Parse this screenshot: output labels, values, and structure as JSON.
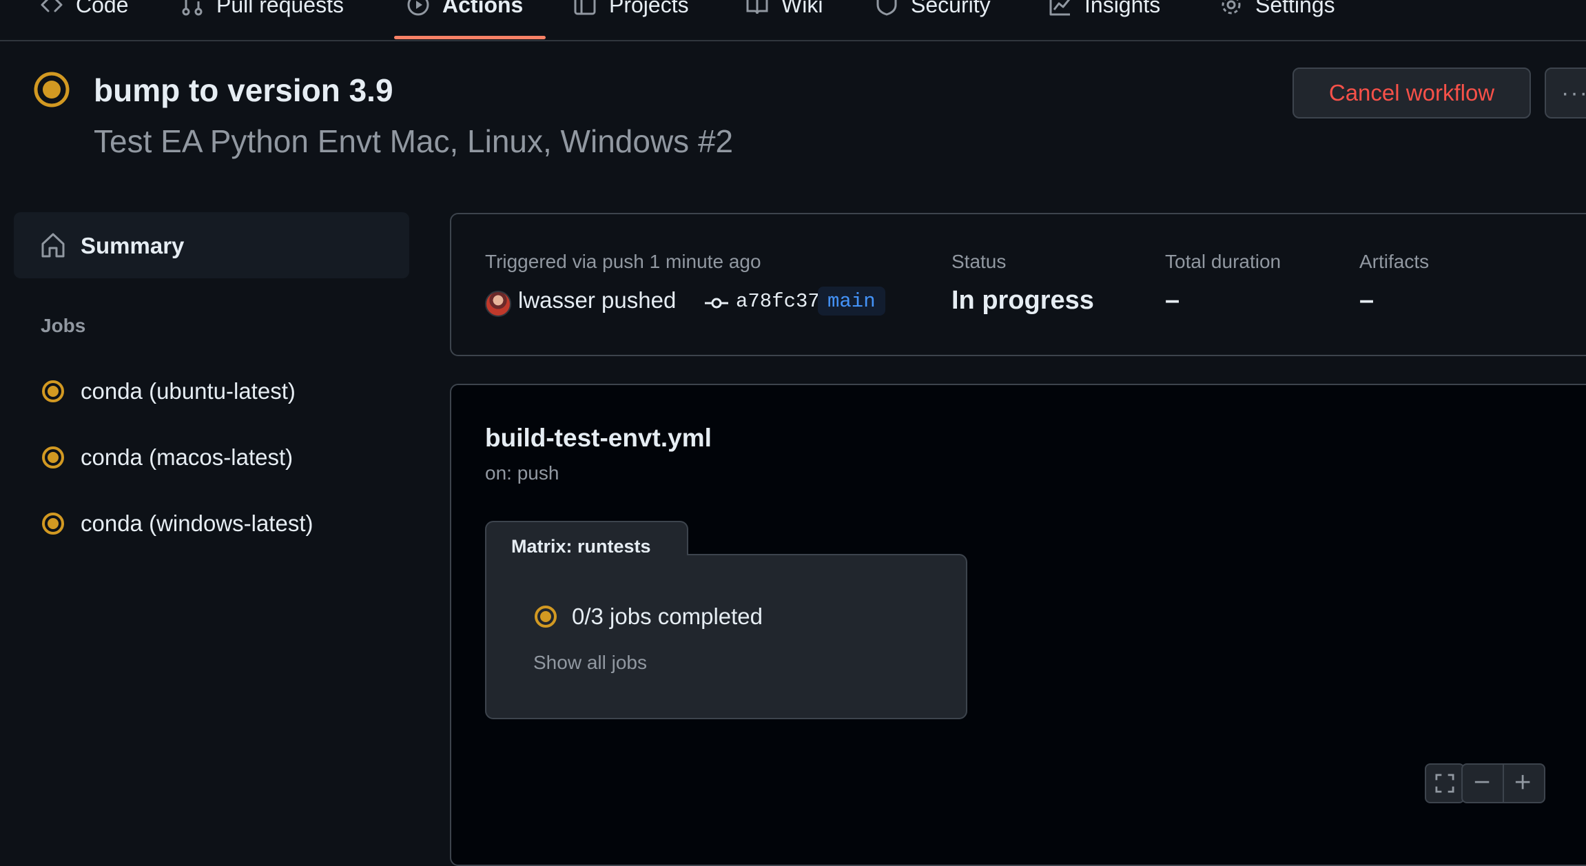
{
  "nav": {
    "tabs": [
      {
        "label": "Code",
        "icon": "code-icon"
      },
      {
        "label": "Pull requests",
        "icon": "git-pull-request-icon"
      },
      {
        "label": "Actions",
        "icon": "play-icon",
        "active": true
      },
      {
        "label": "Projects",
        "icon": "table-icon"
      },
      {
        "label": "Wiki",
        "icon": "book-icon"
      },
      {
        "label": "Security",
        "icon": "shield-icon"
      },
      {
        "label": "Insights",
        "icon": "graph-icon"
      },
      {
        "label": "Settings",
        "icon": "gear-icon"
      }
    ]
  },
  "run": {
    "title": "bump to version 3.9",
    "subtitle": "Test EA Python Envt Mac, Linux, Windows #2",
    "status_icon": "in-progress-icon",
    "cancel_label": "Cancel workflow",
    "more_label": "···"
  },
  "sidebar": {
    "summary_label": "Summary",
    "jobs_heading": "Jobs",
    "jobs": [
      {
        "label": "conda (ubuntu-latest)",
        "status": "in-progress"
      },
      {
        "label": "conda (macos-latest)",
        "status": "in-progress"
      },
      {
        "label": "conda (windows-latest)",
        "status": "in-progress"
      }
    ]
  },
  "summary": {
    "triggered_label": "Triggered via push 1 minute ago",
    "actor": "lwasser pushed",
    "commit_sha": "a78fc37",
    "branch": "main",
    "status_label": "Status",
    "status_value": "In progress",
    "duration_label": "Total duration",
    "duration_value": "–",
    "artifacts_label": "Artifacts",
    "artifacts_value": "–"
  },
  "workflow": {
    "file": "build-test-envt.yml",
    "trigger": "on: push",
    "matrix_label": "Matrix: runtests",
    "matrix_status": "0/3 jobs completed",
    "show_jobs": "Show all jobs"
  },
  "colors": {
    "in_progress": "#d29922",
    "danger": "#f85149",
    "accent_underline": "#f78166",
    "branch_text": "#4493f8"
  }
}
